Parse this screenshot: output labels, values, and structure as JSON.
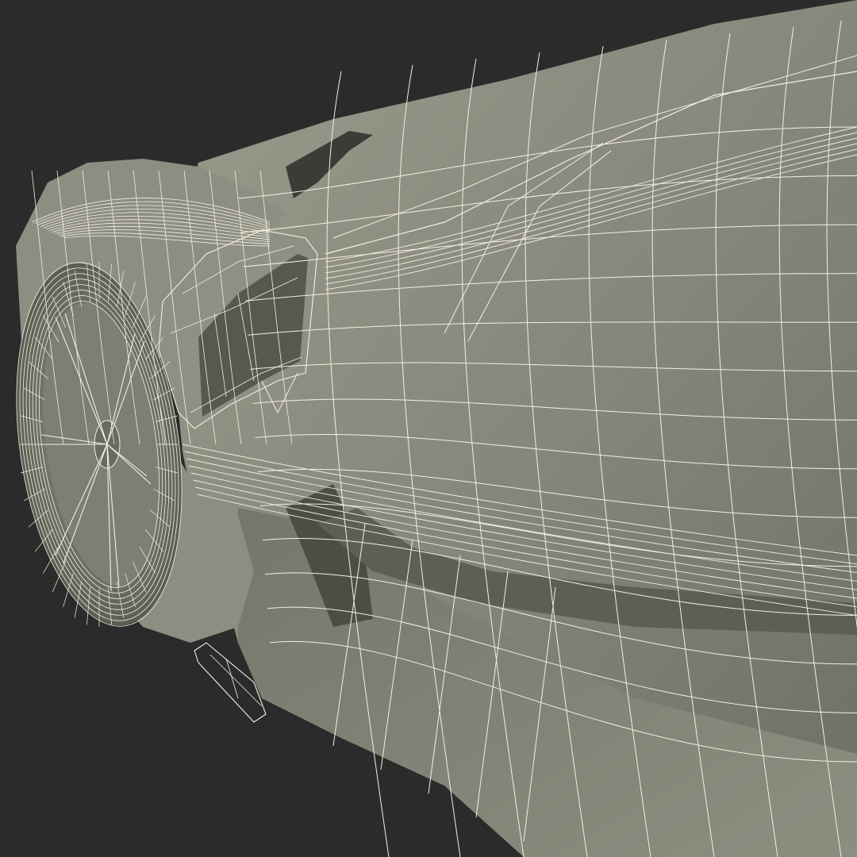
{
  "scene": {
    "subject": "supercar-wireframe-render",
    "background_color": "#2b2b2b",
    "surface_color": "#8a8a7c",
    "surface_shadow_color": "#5f5f55",
    "surface_highlight_color": "#a2a295",
    "wire_color": "#f2f0e2",
    "tire_color": "#707066"
  }
}
